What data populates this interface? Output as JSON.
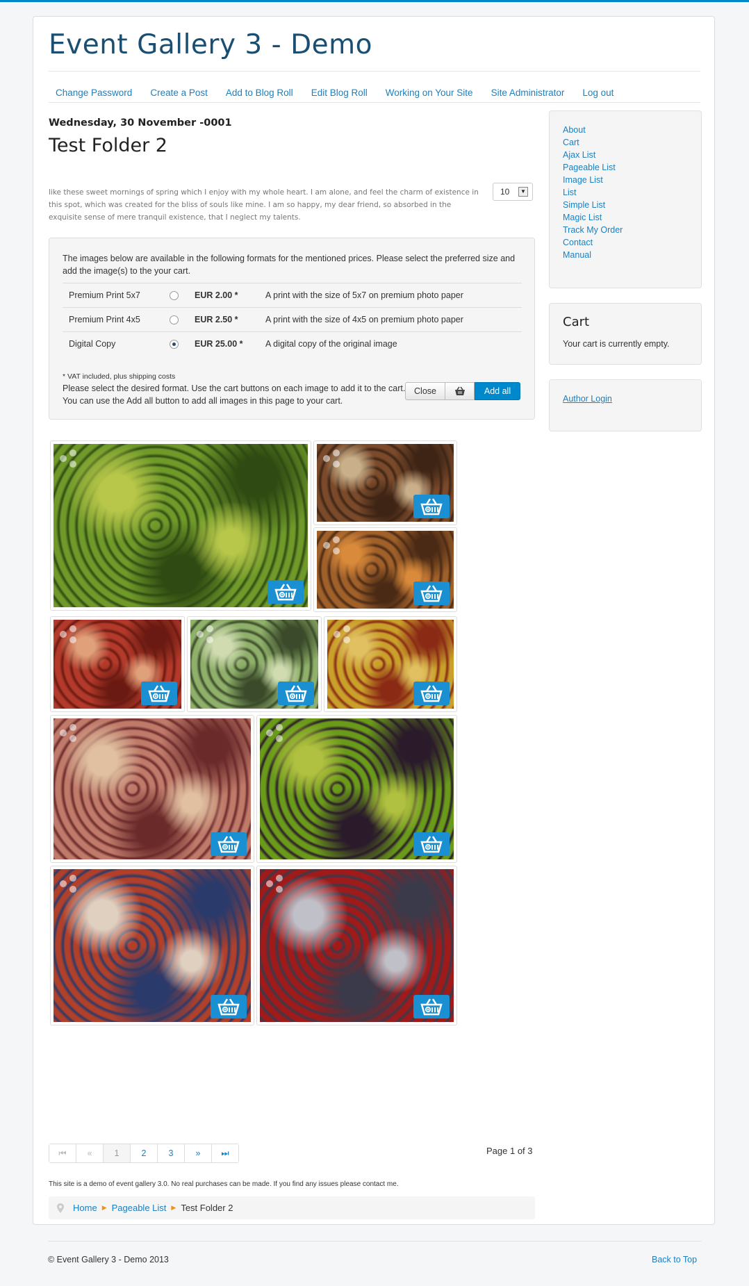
{
  "site": {
    "title": "Event Gallery 3 - Demo"
  },
  "nav": {
    "items": [
      "Change Password",
      "Create a Post",
      "Add to Blog Roll",
      "Edit Blog Roll",
      "Working on Your Site",
      "Site Administrator",
      "Log out"
    ]
  },
  "event": {
    "date": "Wednesday, 30 November -0001",
    "title": "Test Folder 2",
    "description": "like these sweet mornings of spring which I enjoy with my whole heart. I am alone, and feel the charm of existence in this spot, which was created for the bliss of souls like mine. I am so happy, my dear friend, so absorbed in the exquisite sense of mere tranquil existence, that I neglect my talents.",
    "page_size": "10"
  },
  "formats": {
    "intro": "The images below are available in the following formats for the mentioned prices. Please select the preferred size and add the image(s) to the your cart.",
    "rows": [
      {
        "name": "Premium Print 5x7",
        "price": "EUR 2.00 *",
        "description": "A print with the size of 5x7 on premium photo paper",
        "selected": false
      },
      {
        "name": "Premium Print 4x5",
        "price": "EUR 2.50 *",
        "description": "A print with the size of 4x5 on premium photo paper",
        "selected": false
      },
      {
        "name": "Digital Copy",
        "price": "EUR 25.00 *",
        "description": "A digital copy of the original image",
        "selected": true
      }
    ],
    "vat_note": "* VAT included, plus shipping costs",
    "instructions": "Please select the desired format. Use the cart buttons on each image to add it to the cart. You can use the Add all button to add all images in this page to your cart.",
    "close_label": "Close",
    "add_all_label": "Add all"
  },
  "gallery": {
    "images": [
      {
        "subject": "green-tangerines",
        "colors": [
          "#6f9a2a",
          "#2f4a12",
          "#b8c74a"
        ]
      },
      {
        "subject": "spice-boxes",
        "colors": [
          "#7a4a2a",
          "#3d2415",
          "#c9b08a"
        ]
      },
      {
        "subject": "dried-fruits",
        "colors": [
          "#a0602a",
          "#4a2a15",
          "#d98a3a"
        ]
      },
      {
        "subject": "pomegranates",
        "colors": [
          "#b33a2a",
          "#6a1a12",
          "#e0a07a"
        ]
      },
      {
        "subject": "cabbage",
        "colors": [
          "#8fb06a",
          "#3a4a2a",
          "#d0dcb0"
        ]
      },
      {
        "subject": "grapes-and-fruit",
        "colors": [
          "#c9a02a",
          "#8a2a15",
          "#e0c060"
        ]
      },
      {
        "subject": "market-woman",
        "colors": [
          "#c07a6a",
          "#6a2a2a",
          "#e0c0a0"
        ]
      },
      {
        "subject": "eggplants-and-peppers",
        "colors": [
          "#6a9a1a",
          "#2a1a2a",
          "#b0c040"
        ]
      },
      {
        "subject": "vegetable-stall",
        "colors": [
          "#b0402a",
          "#2a3a6a",
          "#e0d0c0"
        ]
      },
      {
        "subject": "fish-trays",
        "colors": [
          "#a01a1a",
          "#3a3a4a",
          "#c0c0c8"
        ]
      }
    ]
  },
  "pagination": {
    "first": "⏮",
    "prev": "«",
    "pages": [
      "1",
      "2",
      "3"
    ],
    "next": "»",
    "last": "⏭",
    "summary": "Page 1 of 3"
  },
  "demo_note": "This site is a demo of event gallery 3.0. No real purchases can be made. If you find any issues please contact me.",
  "breadcrumb": {
    "items": [
      "Home",
      "Pageable List",
      "Test Folder 2"
    ]
  },
  "sidebar": {
    "menu": [
      "About",
      "Cart",
      "Ajax List",
      "Pageable List",
      "Image List",
      "List",
      "Simple List",
      "Magic List",
      "Track My Order",
      "Contact",
      "Manual"
    ],
    "cart_title": "Cart",
    "cart_empty": "Your cart is currently empty.",
    "author_login": "Author Login"
  },
  "footer": {
    "copyright": "© Event Gallery 3 - Demo 2013",
    "back_to_top": "Back to Top"
  },
  "colors": {
    "accent": "#0088cc",
    "link": "#1a80c1",
    "title": "#1b4f72"
  }
}
